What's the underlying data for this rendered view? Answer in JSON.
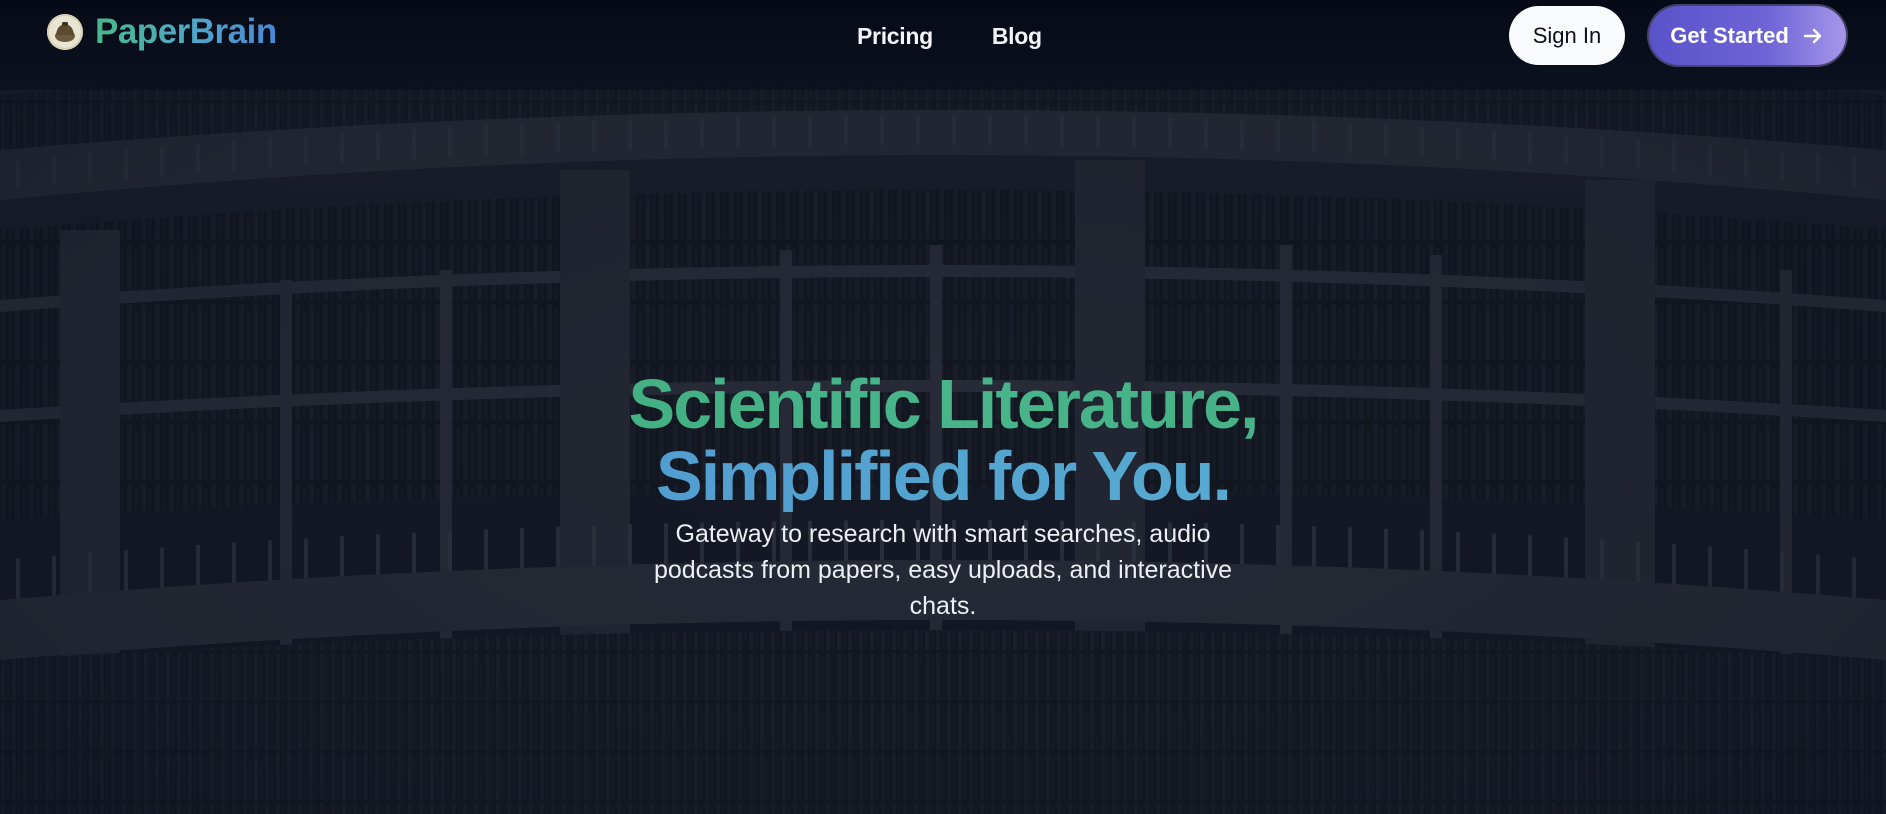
{
  "brand": {
    "name": "PaperBrain",
    "logo_icon": "brain-dome-logo-icon"
  },
  "nav": {
    "items": [
      {
        "label": "Pricing"
      },
      {
        "label": "Blog"
      }
    ]
  },
  "actions": {
    "sign_in_label": "Sign In",
    "get_started_label": "Get Started",
    "get_started_icon": "arrow-right-icon"
  },
  "hero": {
    "title_line1": "Scientific Literature,",
    "title_line2": "Simplified for You.",
    "subtitle": "Gateway to research with smart searches, audio podcasts from papers, easy uploads, and interactive chats."
  },
  "background": {
    "image": "library-bookshelves-background"
  },
  "colors": {
    "header_bg": "#060a16",
    "accent_green": "#44ae82",
    "accent_blue": "#55a8d0",
    "button_purple": "#6e64d6",
    "signin_bg": "#fafbfc"
  }
}
